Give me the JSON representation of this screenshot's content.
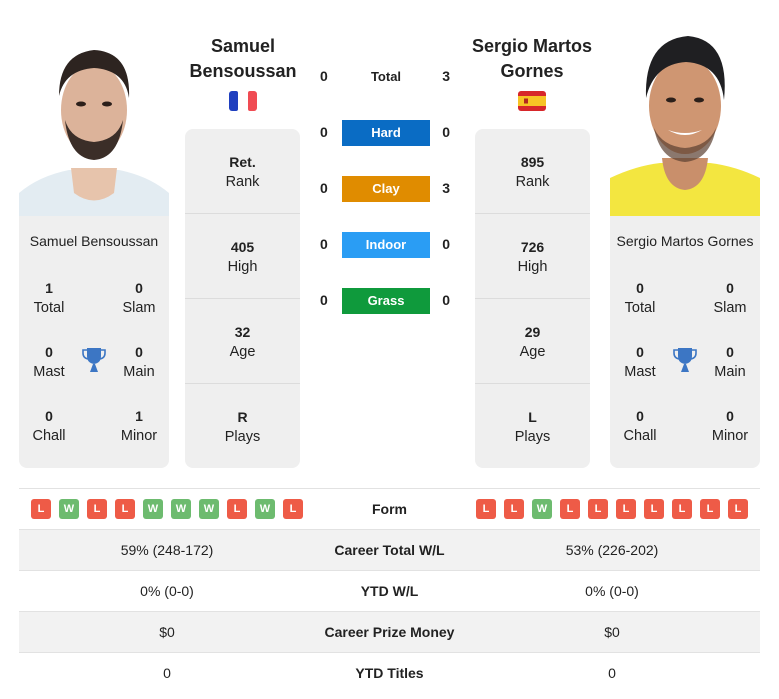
{
  "colors": {
    "hard": "#0a6cc4",
    "clay": "#e08c00",
    "indoor": "#2a9df4",
    "grass": "#0f9a3c",
    "win": "#6dbb6f",
    "loss": "#ee5b47",
    "trophy": "#3c76c4",
    "card_bg": "#efefef"
  },
  "player1": {
    "name_line1": "Samuel",
    "name_line2": "Bensoussan",
    "full_name": "Samuel Bensoussan",
    "country_flag": "france-flag",
    "titles": {
      "total": {
        "value": "1",
        "label": "Total"
      },
      "slam": {
        "value": "0",
        "label": "Slam"
      },
      "mast": {
        "value": "0",
        "label": "Mast"
      },
      "main": {
        "value": "0",
        "label": "Main"
      },
      "chall": {
        "value": "0",
        "label": "Chall"
      },
      "minor": {
        "value": "1",
        "label": "Minor"
      }
    },
    "info": [
      {
        "value": "Ret.",
        "label": "Rank"
      },
      {
        "value": "405",
        "label": "High"
      },
      {
        "value": "32",
        "label": "Age"
      },
      {
        "value": "R",
        "label": "Plays"
      }
    ],
    "form": [
      "L",
      "W",
      "L",
      "L",
      "W",
      "W",
      "W",
      "L",
      "W",
      "L"
    ],
    "career_wl": "59% (248-172)",
    "ytd_wl": "0% (0-0)",
    "prize_money": "$0",
    "ytd_titles": "0"
  },
  "player2": {
    "name_line1": "Sergio Martos",
    "name_line2": "Gornes",
    "full_name": "Sergio Martos Gornes",
    "country_flag": "spain-flag",
    "titles": {
      "total": {
        "value": "0",
        "label": "Total"
      },
      "slam": {
        "value": "0",
        "label": "Slam"
      },
      "mast": {
        "value": "0",
        "label": "Mast"
      },
      "main": {
        "value": "0",
        "label": "Main"
      },
      "chall": {
        "value": "0",
        "label": "Chall"
      },
      "minor": {
        "value": "0",
        "label": "Minor"
      }
    },
    "info": [
      {
        "value": "895",
        "label": "Rank"
      },
      {
        "value": "726",
        "label": "High"
      },
      {
        "value": "29",
        "label": "Age"
      },
      {
        "value": "L",
        "label": "Plays"
      }
    ],
    "form": [
      "L",
      "L",
      "W",
      "L",
      "L",
      "L",
      "L",
      "L",
      "L",
      "L"
    ],
    "career_wl": "53% (226-202)",
    "ytd_wl": "0% (0-0)",
    "prize_money": "$0",
    "ytd_titles": "0"
  },
  "h2h": [
    {
      "label": "Total",
      "p1": "0",
      "p2": "3"
    },
    {
      "label": "Hard",
      "p1": "0",
      "p2": "0"
    },
    {
      "label": "Clay",
      "p1": "0",
      "p2": "3"
    },
    {
      "label": "Indoor",
      "p1": "0",
      "p2": "0"
    },
    {
      "label": "Grass",
      "p1": "0",
      "p2": "0"
    }
  ],
  "table_labels": {
    "form": "Form",
    "career_wl": "Career Total W/L",
    "ytd_wl": "YTD W/L",
    "prize_money": "Career Prize Money",
    "ytd_titles": "YTD Titles"
  }
}
